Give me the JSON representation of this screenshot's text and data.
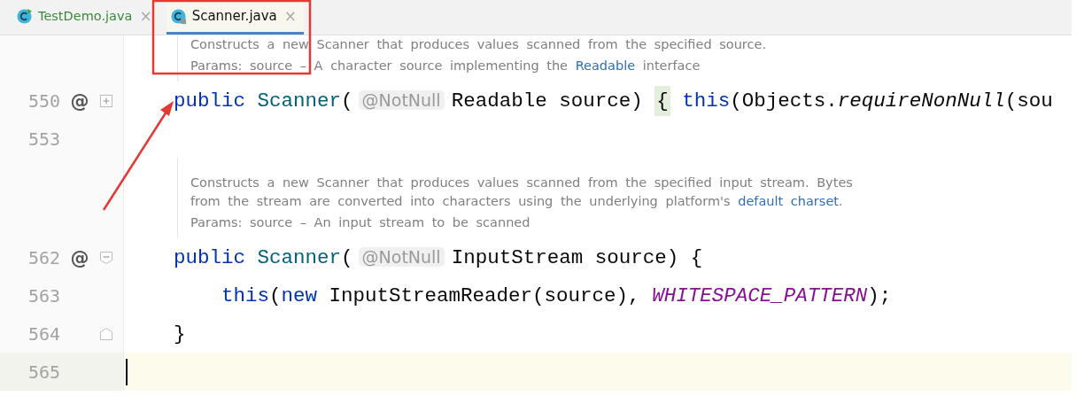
{
  "tabs": [
    {
      "label": "TestDemo.java",
      "selected": false,
      "close": "×"
    },
    {
      "label": "Scanner.java",
      "selected": true,
      "close": "×"
    }
  ],
  "editor": {
    "rows": [
      {
        "kind": "doc",
        "lines": [
          {
            "kind": "text",
            "parts": [
              {
                "text": "Constructs a new Scanner that produces values scanned from the specified source.",
                "link": false
              }
            ]
          },
          {
            "kind": "params",
            "parts": [
              {
                "text": "Params: source – A character source implementing the ",
                "link": false
              },
              {
                "text": "Readable",
                "link": true
              },
              {
                "text": " interface",
                "link": false
              }
            ]
          }
        ]
      },
      {
        "kind": "code",
        "number": "550",
        "marker": "@",
        "fold": {
          "kind": "collapsed"
        },
        "current": false,
        "caret": false,
        "tokens": [
          {
            "kind": "keyword",
            "text": "public "
          },
          {
            "kind": "type",
            "text": "Scanner"
          },
          {
            "kind": "plain",
            "text": "("
          },
          {
            "kind": "annotation",
            "text": "@NotNull"
          },
          {
            "kind": "plain",
            "text": "Readable source) "
          },
          {
            "kind": "brace",
            "text": "{"
          },
          {
            "kind": "keyword",
            "text": " this"
          },
          {
            "kind": "plain",
            "text": "(Objects."
          },
          {
            "kind": "method",
            "text": "requireNonNull"
          },
          {
            "kind": "plain",
            "text": "(sou"
          }
        ]
      },
      {
        "kind": "code",
        "number": "553",
        "current": false,
        "caret": false,
        "tokens": []
      },
      {
        "kind": "doc",
        "lines": [
          {
            "kind": "text",
            "parts": [
              {
                "text": "Constructs a new Scanner that produces values scanned from the specified input stream. Bytes from the stream are converted into characters using the underlying platform's ",
                "link": false
              },
              {
                "text": "default charset",
                "link": true
              },
              {
                "text": ".",
                "link": false
              }
            ]
          },
          {
            "kind": "params",
            "parts": [
              {
                "text": "Params: source – An input stream to be scanned",
                "link": false
              }
            ]
          }
        ]
      },
      {
        "kind": "code",
        "number": "562",
        "marker": "@",
        "fold": {
          "kind": "start"
        },
        "current": false,
        "caret": false,
        "tokens": [
          {
            "kind": "keyword",
            "text": "public "
          },
          {
            "kind": "type",
            "text": "Scanner"
          },
          {
            "kind": "plain",
            "text": "("
          },
          {
            "kind": "annotation",
            "text": "@NotNull"
          },
          {
            "kind": "plain",
            "text": "InputStream source) {"
          }
        ]
      },
      {
        "kind": "code",
        "number": "563",
        "current": false,
        "caret": false,
        "tokens": [
          {
            "kind": "keyword",
            "text": "    this"
          },
          {
            "kind": "plain",
            "text": "("
          },
          {
            "kind": "keyword",
            "text": "new"
          },
          {
            "kind": "plain",
            "text": " InputStreamReader(source), "
          },
          {
            "kind": "constant",
            "text": "WHITESPACE_PATTERN"
          },
          {
            "kind": "plain",
            "text": ");"
          }
        ]
      },
      {
        "kind": "code",
        "number": "564",
        "fold": {
          "kind": "end"
        },
        "current": false,
        "caret": false,
        "tokens": [
          {
            "kind": "plain",
            "text": "}"
          }
        ]
      },
      {
        "kind": "code",
        "number": "565",
        "current": true,
        "caret": true,
        "tokens": []
      }
    ]
  }
}
